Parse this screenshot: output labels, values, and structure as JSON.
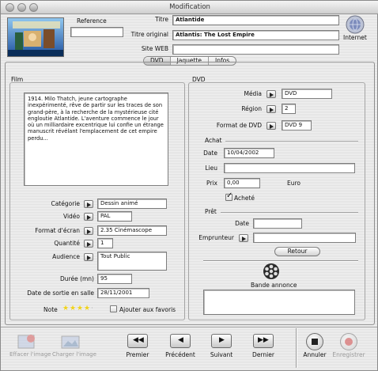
{
  "window": {
    "title": "Modification"
  },
  "header": {
    "reference_label": "Reference",
    "reference_value": "",
    "titre_label": "Titre",
    "titre_value": "Atlantide",
    "titre_original_label": "Titre original",
    "titre_original_value": "Atlantis: The Lost Empire",
    "site_web_label": "Site WEB",
    "site_web_value": "",
    "internet_label": "Internet"
  },
  "tabs": [
    {
      "label": "DVD",
      "selected": true
    },
    {
      "label": "Jaquette",
      "selected": false
    },
    {
      "label": "Infos",
      "selected": false
    }
  ],
  "film": {
    "group_label": "Film",
    "synopsis": "1914. Milo Thatch, jeune cartographe inexpérimenté, rêve de partir sur les traces de son grand-père, à la recherche de la mystérieuse cité engloutie Atlantide. L'aventure commence le jour où un milliardaire excentrique lui confie un étrange manuscrit révélant l'emplacement de cet empire perdu...",
    "categorie_label": "Catégorie",
    "categorie_value": "Dessin animé",
    "video_label": "Vidéo",
    "video_value": "PAL",
    "format_ecran_label": "Format d'écran",
    "format_ecran_value": "2.35 Cinémascope",
    "quantite_label": "Quantité",
    "quantite_value": "1",
    "audience_label": "Audience",
    "audience_value": "Tout Public",
    "duree_label": "Durée (mn)",
    "duree_value": "95",
    "date_sortie_label": "Date de sortie en salle",
    "date_sortie_value": "28/11/2001",
    "note_label": "Note",
    "note_stars": 4,
    "favoris_label": "Ajouter aux favoris",
    "favoris_checked": false
  },
  "dvd": {
    "group_label": "DVD",
    "media_label": "Média",
    "media_value": "DVD",
    "region_label": "Région",
    "region_value": "2",
    "format_dvd_label": "Format de DVD",
    "format_dvd_value": "DVD 9",
    "achat_label": "Achat",
    "achat_date_label": "Date",
    "achat_date_value": "10/04/2002",
    "lieu_label": "Lieu",
    "lieu_value": "",
    "prix_label": "Prix",
    "prix_value": "0,00",
    "currency": "Euro",
    "achete_label": "Acheté",
    "achete_checked": true,
    "pret_label": "Prêt",
    "pret_date_label": "Date",
    "pret_date_value": "",
    "emprunteur_label": "Emprunteur",
    "emprunteur_value": "",
    "retour_label": "Retour",
    "bande_annonce_label": "Bande annonce",
    "bande_annonce_value": ""
  },
  "toolbar": {
    "effacer_image": "Effacer l'image",
    "charger_image": "Charger l'image",
    "premier": "Premier",
    "precedent": "Précédent",
    "suivant": "Suivant",
    "dernier": "Dernier",
    "annuler": "Annuler",
    "enregistrer": "Enregistrer"
  },
  "colors": {
    "star": "#f0d21a",
    "enregistrer": "#d44a4a"
  }
}
